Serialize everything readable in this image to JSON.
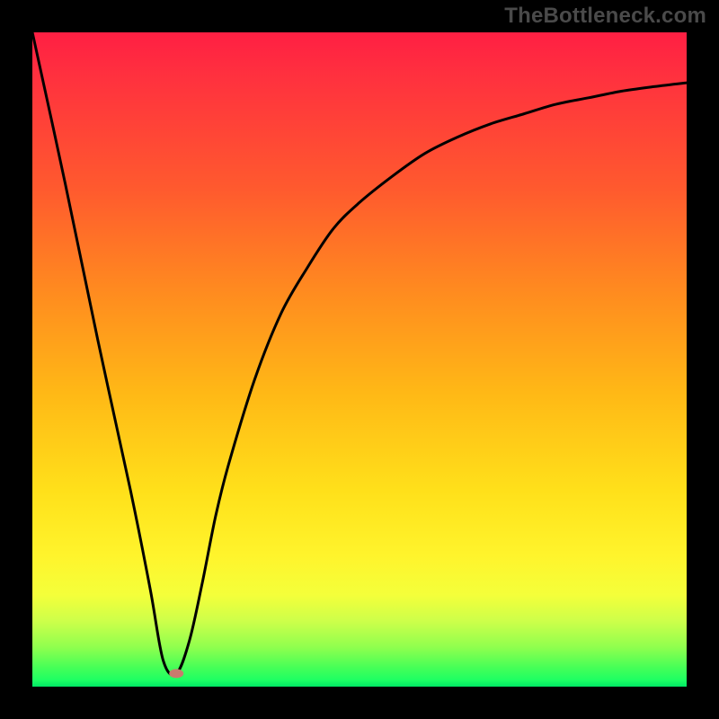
{
  "watermark": "TheBottleneck.com",
  "chart_data": {
    "type": "line",
    "title": "",
    "xlabel": "",
    "ylabel": "",
    "xlim": [
      0,
      100
    ],
    "ylim": [
      0,
      100
    ],
    "x": [
      0,
      5,
      10,
      15,
      18,
      20,
      22,
      24,
      26,
      28,
      30,
      34,
      38,
      42,
      46,
      50,
      55,
      60,
      65,
      70,
      75,
      80,
      85,
      90,
      95,
      100
    ],
    "values": [
      100,
      77,
      53,
      30,
      15,
      4,
      2,
      7,
      16,
      26,
      34,
      47,
      57,
      64,
      70,
      74,
      78,
      81.5,
      84,
      86,
      87.5,
      89,
      90,
      91,
      91.7,
      92.3
    ],
    "note": "Estimated curve values read from the image, scaled 0–100 on both axes.",
    "background_gradient": {
      "direction": "top_to_bottom",
      "stops": [
        {
          "pos": 0.0,
          "color": "#ff1f43"
        },
        {
          "pos": 0.24,
          "color": "#ff5a2e"
        },
        {
          "pos": 0.55,
          "color": "#ffb816"
        },
        {
          "pos": 0.8,
          "color": "#fff42c"
        },
        {
          "pos": 0.94,
          "color": "#8fff4e"
        },
        {
          "pos": 1.0,
          "color": "#00e765"
        }
      ]
    },
    "marker": {
      "x": 22,
      "y": 2,
      "color": "#c97a6e",
      "rx": 8,
      "ry": 5
    }
  }
}
